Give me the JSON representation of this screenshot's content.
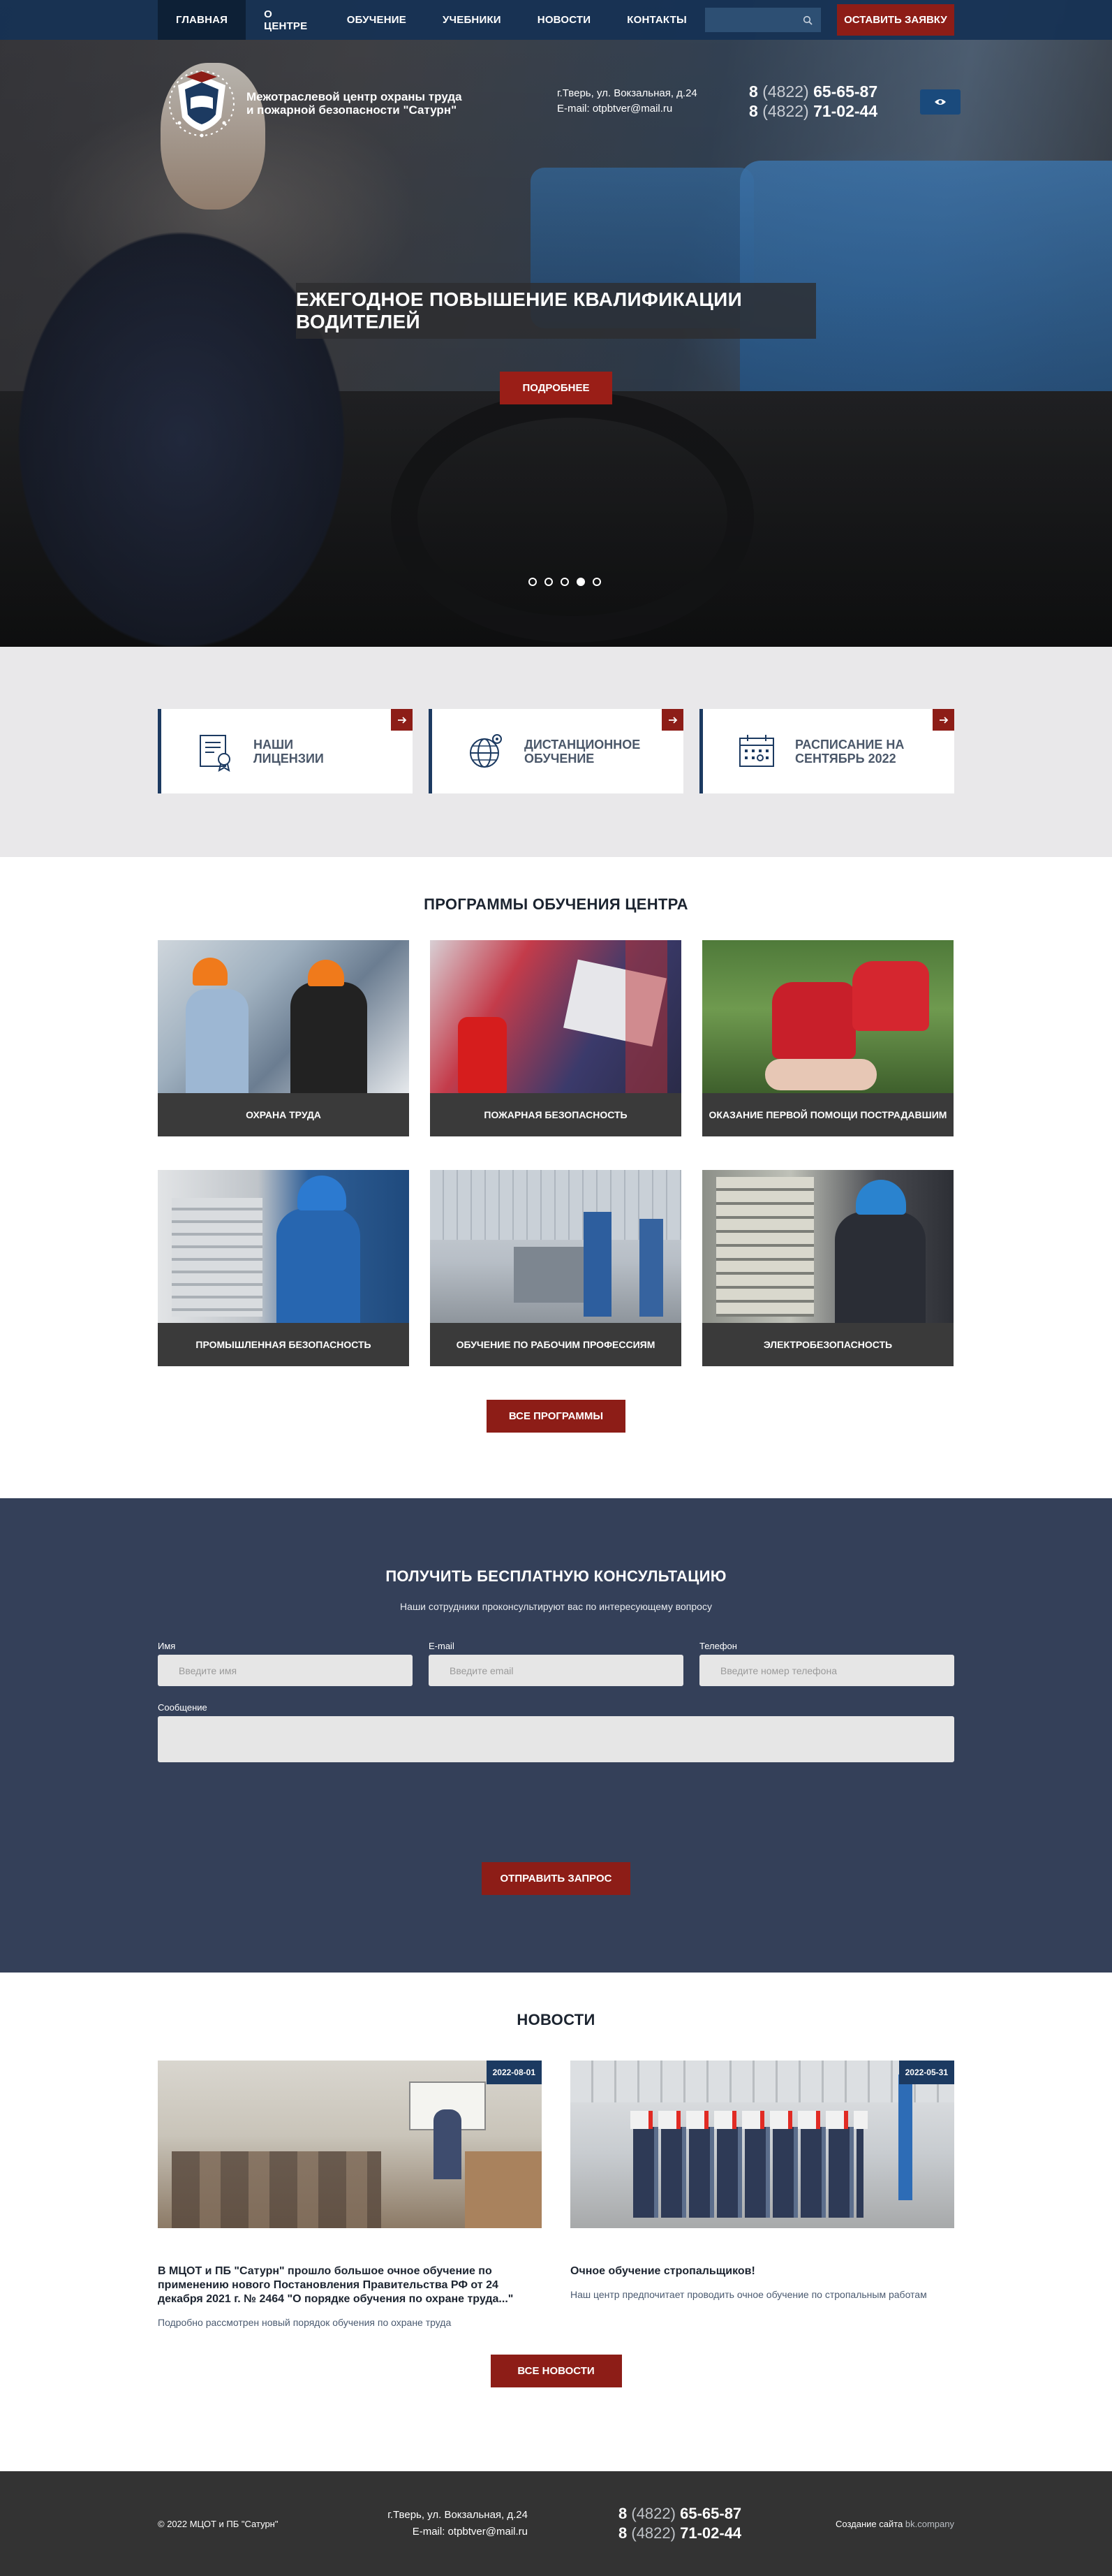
{
  "nav": {
    "items": [
      "ГЛАВНАЯ",
      "О ЦЕНТРЕ",
      "ОБУЧЕНИЕ",
      "УЧЕБНИКИ",
      "НОВОСТИ",
      "КОНТАКТЫ"
    ],
    "active_index": 0,
    "cta": "ОСТАВИТЬ ЗАЯВКУ"
  },
  "header": {
    "logo_line1": "Межотраслевой центр охраны труда",
    "logo_line2": "и пожарной безопасности \"Сатурн\"",
    "address": "г.Тверь, ул. Вокзальная, д.24",
    "email": "E-mail: otpbtver@mail.ru",
    "phone1_prefix": "8",
    "phone1_code": "(4822)",
    "phone1_number": "65-65-87",
    "phone2_prefix": "8",
    "phone2_code": "(4822)",
    "phone2_number": "71-02-44"
  },
  "hero": {
    "title": "ЕЖЕГОДНОЕ ПОВЫШЕНИЕ КВАЛИФИКАЦИИ ВОДИТЕЛЕЙ",
    "button": "ПОДРОБНЕЕ",
    "slides_count": 5,
    "active_slide": 4
  },
  "cards": [
    {
      "line1": "НАШИ",
      "line2": "ЛИЦЕНЗИИ",
      "icon": "certificate-icon"
    },
    {
      "line1": "ДИСТАНЦИОННОЕ",
      "line2": "ОБУЧЕНИЕ",
      "icon": "globe-icon"
    },
    {
      "line1": "РАСПИСАНИЕ НА",
      "line2": "СЕНТЯБРЬ 2022",
      "icon": "calendar-icon"
    }
  ],
  "programs": {
    "title": "ПРОГРАММЫ ОБУЧЕНИЯ ЦЕНТРА",
    "items": [
      "ОХРАНА ТРУДА",
      "ПОЖАРНАЯ БЕЗОПАСНОСТЬ",
      "ОКАЗАНИЕ ПЕРВОЙ ПОМОЩИ ПОСТРАДАВШИМ",
      "ПРОМЫШЛЕННАЯ БЕЗОПАСНОСТЬ",
      "ОБУЧЕНИЕ ПО РАБОЧИМ ПРОФЕССИЯМ",
      "ЭЛЕКТРОБЕЗОПАСНОСТЬ"
    ],
    "button": "ВСЕ ПРОГРАММЫ"
  },
  "consult": {
    "title": "ПОЛУЧИТЬ БЕСПЛАТНУЮ КОНСУЛЬТАЦИЮ",
    "subtitle": "Наши сотрудники проконсультируют вас по интересующему вопросу",
    "name_label": "Имя",
    "name_placeholder": "Введите имя",
    "email_label": "E-mail",
    "email_placeholder": "Введите email",
    "phone_label": "Телефон",
    "phone_placeholder": "Введите номер телефона",
    "message_label": "Сообщение",
    "button": "ОТПРАВИТЬ ЗАПРОС"
  },
  "news": {
    "title": "НОВОСТИ",
    "items": [
      {
        "date": "2022-08-01",
        "title": "В МЦОТ и ПБ \"Сатурн\" прошло большое очное обучение по применению нового Постановления Правительства РФ от 24 декабря 2021 г. № 2464 \"О порядке обучения по охране труда...\"",
        "text": "Подробно рассмотрен новый порядок обучения по охране труда"
      },
      {
        "date": "2022-05-31",
        "title": "Очное обучение стропальщиков!",
        "text": "Наш центр предпочитает проводить очное обучение по стропальным работам"
      }
    ],
    "button": "ВСЕ НОВОСТИ"
  },
  "footer": {
    "copyright": "© 2022 МЦОТ и ПБ \"Сатурн\"",
    "address": "г.Тверь, ул. Вокзальная, д.24",
    "email": "E-mail: otpbtver@mail.ru",
    "phone1_prefix": "8",
    "phone1_code": "(4822)",
    "phone1_number": "65-65-87",
    "phone2_prefix": "8",
    "phone2_code": "(4822)",
    "phone2_number": "71-02-44",
    "made_by": "Создание сайта",
    "made_by_brand": "bk.company"
  },
  "colors": {
    "nav_bg": "#163254",
    "accent_red": "#8d1d17",
    "consult_bg": "#344059",
    "footer_bg": "#333333"
  }
}
